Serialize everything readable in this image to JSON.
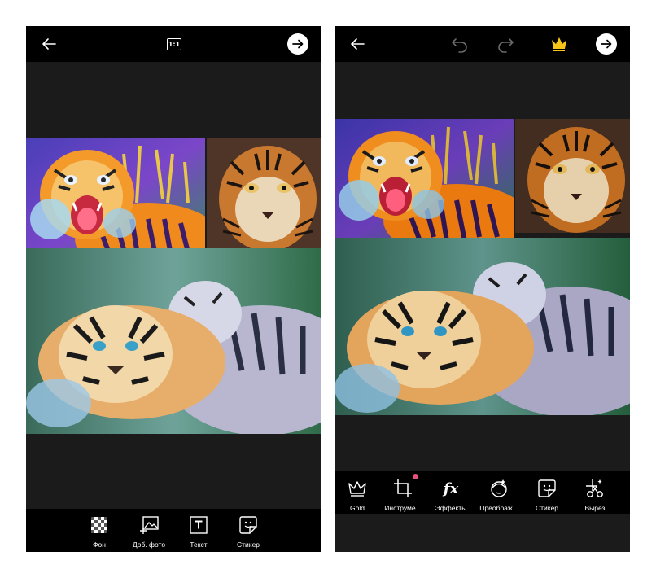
{
  "left_screen": {
    "ratio_label": "1:1",
    "tools": [
      {
        "label": "Фон",
        "icon": "checkerboard-icon"
      },
      {
        "label": "Доб. фото",
        "icon": "add-photo-icon"
      },
      {
        "label": "Текст",
        "icon": "text-icon"
      },
      {
        "label": "Стикер",
        "icon": "sticker-icon"
      }
    ]
  },
  "right_screen": {
    "tools": [
      {
        "label": "Gold",
        "icon": "crown-outline-icon"
      },
      {
        "label": "Инструме...",
        "icon": "crop-icon"
      },
      {
        "label": "Эффекты",
        "icon": "fx-icon"
      },
      {
        "label": "Преображ...",
        "icon": "beautify-icon"
      },
      {
        "label": "Стикер",
        "icon": "sticker-icon"
      },
      {
        "label": "Вырез",
        "icon": "cutout-icon"
      }
    ]
  },
  "colors": {
    "screen_bg": "#1b1b1b",
    "bar_bg": "#000000",
    "crown_gold": "#f5c518",
    "notification_dot": "#e8507c"
  }
}
